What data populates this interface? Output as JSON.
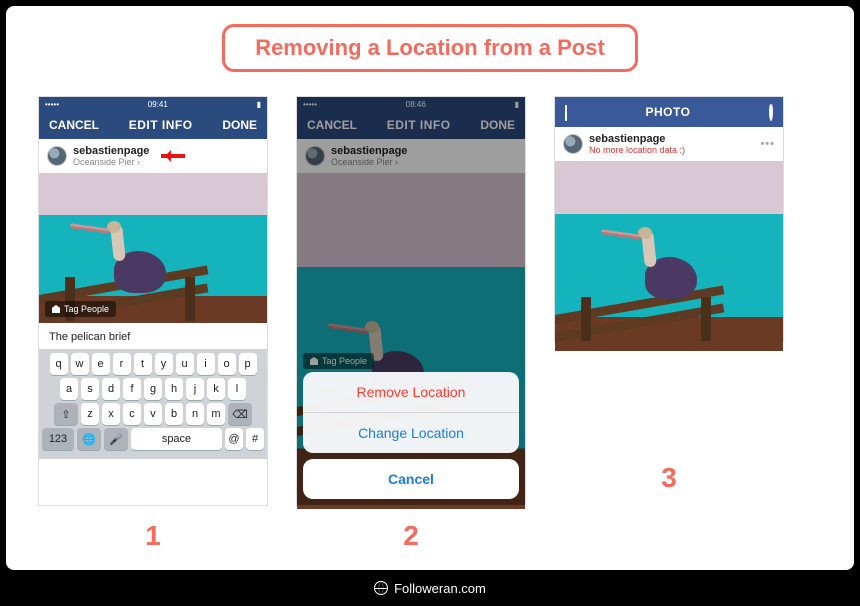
{
  "title": "Removing a Location from a Post",
  "steps": {
    "s1": "1",
    "s2": "2",
    "s3": "3"
  },
  "footer": "Followeran.com",
  "status": {
    "time1": "09:41",
    "time2": "08:46",
    "carrier_dots": "•••••",
    "wifi": "⚙",
    "battery": "▮"
  },
  "screen1": {
    "nav": {
      "left": "CANCEL",
      "center": "EDIT INFO",
      "right": "DONE"
    },
    "username": "sebastienpage",
    "location": "Oceanside Pier ›",
    "tag_people": "Tag People",
    "caption": "The pelican brief",
    "keyboard": {
      "r1": [
        "q",
        "w",
        "e",
        "r",
        "t",
        "y",
        "u",
        "i",
        "o",
        "p"
      ],
      "r2": [
        "a",
        "s",
        "d",
        "f",
        "g",
        "h",
        "j",
        "k",
        "l"
      ],
      "r3_shift": "⇧",
      "r3": [
        "z",
        "x",
        "c",
        "v",
        "b",
        "n",
        "m"
      ],
      "r3_del": "⌫",
      "r4_123": "123",
      "r4_globe": "🌐",
      "r4_mic": "🎤",
      "r4_space": "space",
      "r4_at": "@",
      "r4_hash": "#"
    }
  },
  "screen2": {
    "nav": {
      "left": "CANCEL",
      "center": "EDIT INFO",
      "right": "DONE"
    },
    "username": "sebastienpage",
    "location": "Oceanside Pier ›",
    "tag_people": "Tag People",
    "sheet": {
      "remove": "Remove Location",
      "change": "Change Location",
      "cancel": "Cancel"
    }
  },
  "screen3": {
    "nav_center": "PHOTO",
    "username": "sebastienpage",
    "no_location": "No more location data :)",
    "more": "•••"
  }
}
